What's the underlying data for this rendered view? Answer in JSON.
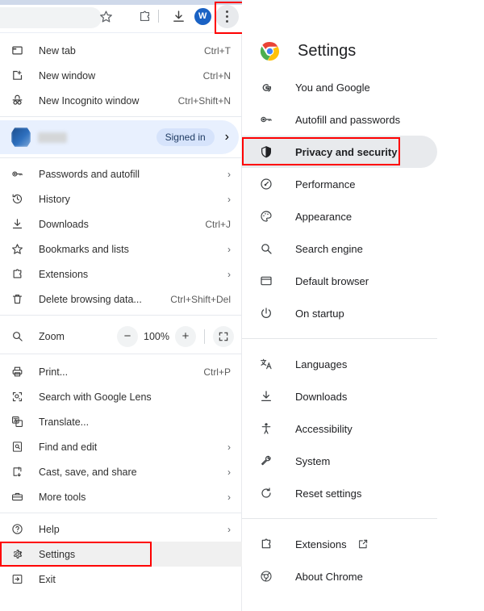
{
  "toolbar": {
    "star_icon": "bookmark-star-icon",
    "extensions_icon": "extensions-puzzle-icon",
    "download_icon": "downloads-icon",
    "avatar_initial": "W",
    "menu_icon": "three-dot-menu-icon",
    "highlight_color": "#fe0000"
  },
  "menu": {
    "group1": [
      {
        "label": "New tab",
        "accel": "Ctrl+T",
        "icon": "new-tab-icon",
        "chevron": false
      },
      {
        "label": "New window",
        "accel": "Ctrl+N",
        "icon": "new-window-icon",
        "chevron": false
      },
      {
        "label": "New Incognito window",
        "accel": "Ctrl+Shift+N",
        "icon": "incognito-icon",
        "chevron": false
      }
    ],
    "profile": {
      "status_chip": "Signed in",
      "chevron": "›"
    },
    "group2": [
      {
        "label": "Passwords and autofill",
        "accel": "",
        "icon": "key-icon",
        "chevron": true
      },
      {
        "label": "History",
        "accel": "",
        "icon": "history-icon",
        "chevron": true
      },
      {
        "label": "Downloads",
        "accel": "Ctrl+J",
        "icon": "download-icon",
        "chevron": false
      },
      {
        "label": "Bookmarks and lists",
        "accel": "",
        "icon": "star-icon",
        "chevron": true
      },
      {
        "label": "Extensions",
        "accel": "",
        "icon": "puzzle-icon",
        "chevron": true
      },
      {
        "label": "Delete browsing data...",
        "accel": "Ctrl+Shift+Del",
        "icon": "trash-icon",
        "chevron": false
      }
    ],
    "zoom": {
      "label": "Zoom",
      "icon": "zoom-magnifier-icon",
      "minus": "−",
      "level": "100%",
      "plus": "+",
      "fullscreen_icon": "fullscreen-icon"
    },
    "group3": [
      {
        "label": "Print...",
        "accel": "Ctrl+P",
        "icon": "printer-icon",
        "chevron": false
      },
      {
        "label": "Search with Google Lens",
        "accel": "",
        "icon": "google-lens-icon",
        "chevron": false
      },
      {
        "label": "Translate...",
        "accel": "",
        "icon": "translate-icon",
        "chevron": false
      },
      {
        "label": "Find and edit",
        "accel": "",
        "icon": "find-edit-icon",
        "chevron": true
      },
      {
        "label": "Cast, save, and share",
        "accel": "",
        "icon": "cast-share-icon",
        "chevron": true
      },
      {
        "label": "More tools",
        "accel": "",
        "icon": "more-tools-icon",
        "chevron": true
      }
    ],
    "group4": [
      {
        "label": "Help",
        "accel": "",
        "icon": "help-icon",
        "chevron": true,
        "highlighted": false
      },
      {
        "label": "Settings",
        "accel": "",
        "icon": "gear-icon",
        "chevron": false,
        "highlighted": true
      },
      {
        "label": "Exit",
        "accel": "",
        "icon": "exit-icon",
        "chevron": false,
        "highlighted": false
      }
    ]
  },
  "settings": {
    "title": "Settings",
    "logo_icon": "chrome-logo-icon",
    "group1": [
      {
        "label": "You and Google",
        "icon": "google-g-icon",
        "active": false
      },
      {
        "label": "Autofill and passwords",
        "icon": "key-icon",
        "active": false
      },
      {
        "label": "Privacy and security",
        "icon": "shield-icon",
        "active": true
      },
      {
        "label": "Performance",
        "icon": "speedometer-icon",
        "active": false
      },
      {
        "label": "Appearance",
        "icon": "palette-icon",
        "active": false
      },
      {
        "label": "Search engine",
        "icon": "search-icon",
        "active": false
      },
      {
        "label": "Default browser",
        "icon": "browser-window-icon",
        "active": false
      },
      {
        "label": "On startup",
        "icon": "power-icon",
        "active": false
      }
    ],
    "group2": [
      {
        "label": "Languages",
        "icon": "translate-languages-icon",
        "active": false
      },
      {
        "label": "Downloads",
        "icon": "download-icon",
        "active": false
      },
      {
        "label": "Accessibility",
        "icon": "accessibility-icon",
        "active": false
      },
      {
        "label": "System",
        "icon": "wrench-icon",
        "active": false
      },
      {
        "label": "Reset settings",
        "icon": "reset-icon",
        "active": false
      }
    ],
    "group3": [
      {
        "label": "Extensions",
        "icon": "puzzle-icon",
        "external": true,
        "external_icon": "open-in-new-icon"
      },
      {
        "label": "About Chrome",
        "icon": "chrome-mono-icon",
        "external": false,
        "external_icon": ""
      }
    ]
  }
}
